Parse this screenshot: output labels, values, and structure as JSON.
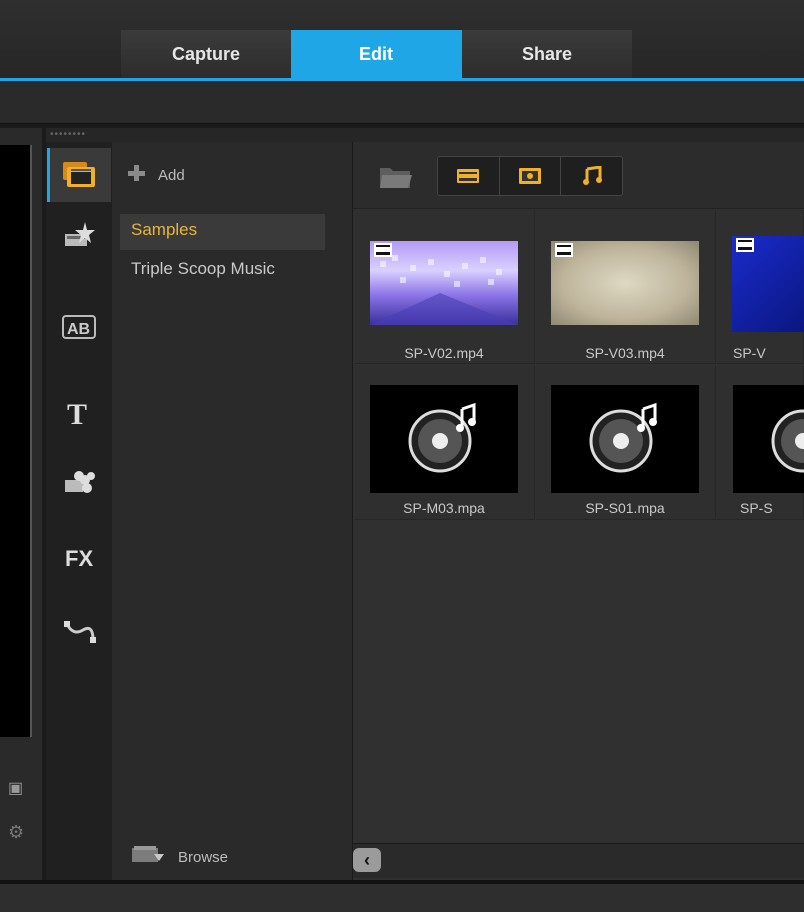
{
  "tabs": [
    {
      "label": "Capture"
    },
    {
      "label": "Edit"
    },
    {
      "label": "Share"
    }
  ],
  "side_icons": [
    "media-icon",
    "instant-project-icon",
    "transition-icon",
    "title-icon",
    "graphic-icon",
    "filter-icon",
    "path-icon"
  ],
  "library": {
    "add_label": "Add",
    "browse_label": "Browse",
    "folders": [
      "Samples",
      "Triple Scoop Music"
    ],
    "selected_folder": "Samples"
  },
  "media": [
    {
      "name": "SP-V02.mp4",
      "kind": "video"
    },
    {
      "name": "SP-V03.mp4",
      "kind": "video"
    },
    {
      "name": "SP-V",
      "kind": "video"
    },
    {
      "name": "SP-M03.mpa",
      "kind": "audio"
    },
    {
      "name": "SP-S01.mpa",
      "kind": "audio"
    },
    {
      "name": "SP-S",
      "kind": "audio"
    }
  ],
  "colors": {
    "accent": "#1ea6e6",
    "selected_folder": "#e9b53a"
  }
}
